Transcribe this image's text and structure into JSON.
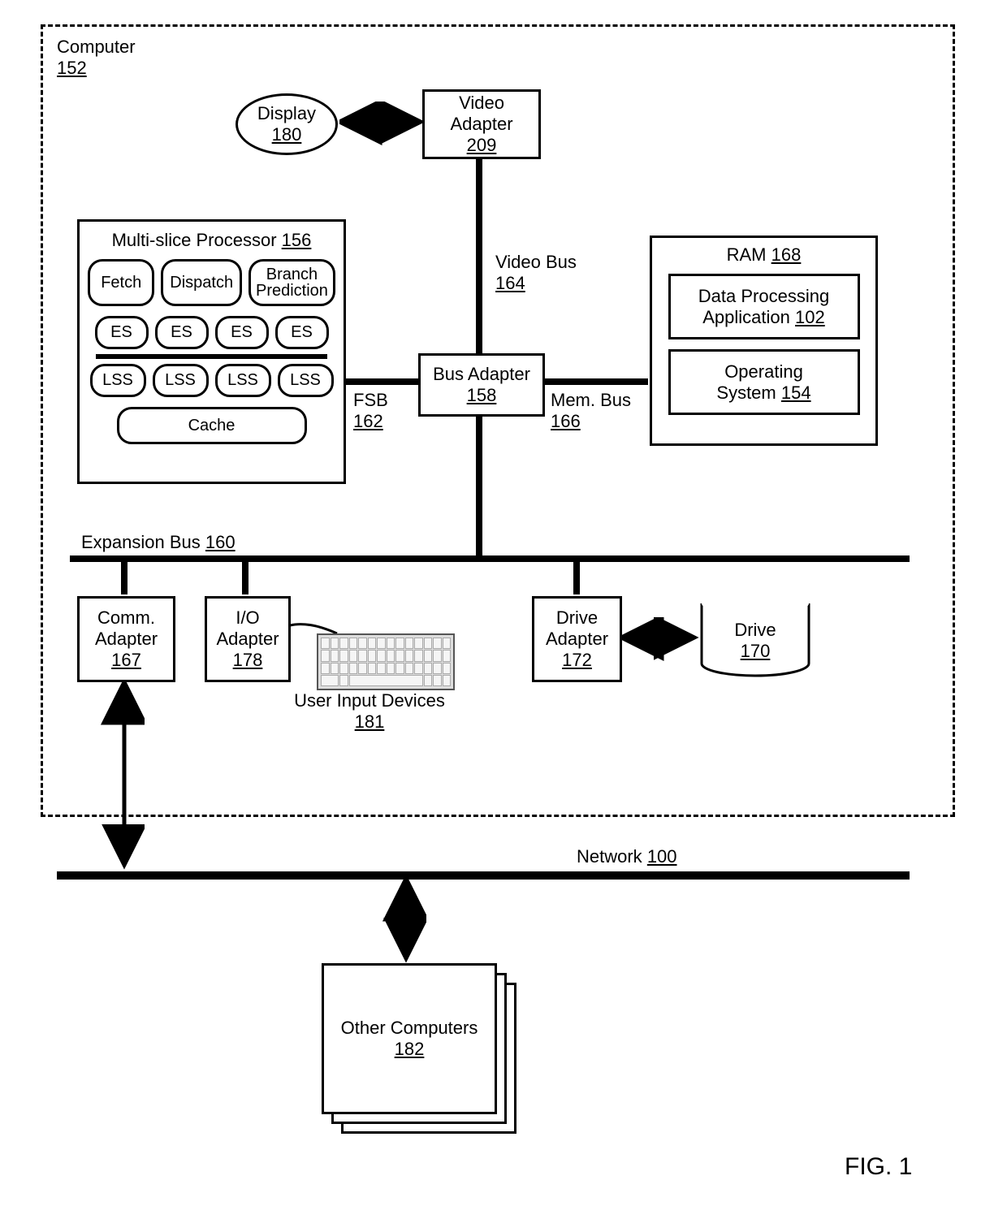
{
  "figure_label": "FIG. 1",
  "computer": {
    "label": "Computer",
    "num": "152"
  },
  "display": {
    "label": "Display",
    "num": "180"
  },
  "video_adapter": {
    "label": "Video",
    "label2": "Adapter",
    "num": "209"
  },
  "video_bus": {
    "label": "Video Bus",
    "num": "164"
  },
  "processor": {
    "title": "Multi-slice Processor",
    "num": "156",
    "fetch": "Fetch",
    "dispatch": "Dispatch",
    "branch": "Branch",
    "prediction": "Prediction",
    "es": "ES",
    "lss": "LSS",
    "cache": "Cache"
  },
  "fsb": {
    "label": "FSB",
    "num": "162"
  },
  "bus_adapter": {
    "label": "Bus Adapter",
    "num": "158"
  },
  "mem_bus": {
    "label": "Mem. Bus",
    "num": "166"
  },
  "ram": {
    "label": "RAM",
    "num": "168",
    "app_label1": "Data Processing",
    "app_label2": "Application",
    "app_num": "102",
    "os_label1": "Operating",
    "os_label2": "System",
    "os_num": "154"
  },
  "expansion_bus": {
    "label": "Expansion Bus",
    "num": "160"
  },
  "comm_adapter": {
    "label1": "Comm.",
    "label2": "Adapter",
    "num": "167"
  },
  "io_adapter": {
    "label1": "I/O",
    "label2": "Adapter",
    "num": "178"
  },
  "user_input": {
    "label": "User Input Devices",
    "num": "181"
  },
  "drive_adapter": {
    "label1": "Drive",
    "label2": "Adapter",
    "num": "172"
  },
  "drive": {
    "label": "Drive",
    "num": "170"
  },
  "network": {
    "label": "Network",
    "num": "100"
  },
  "other_computers": {
    "label": "Other Computers",
    "num": "182"
  }
}
